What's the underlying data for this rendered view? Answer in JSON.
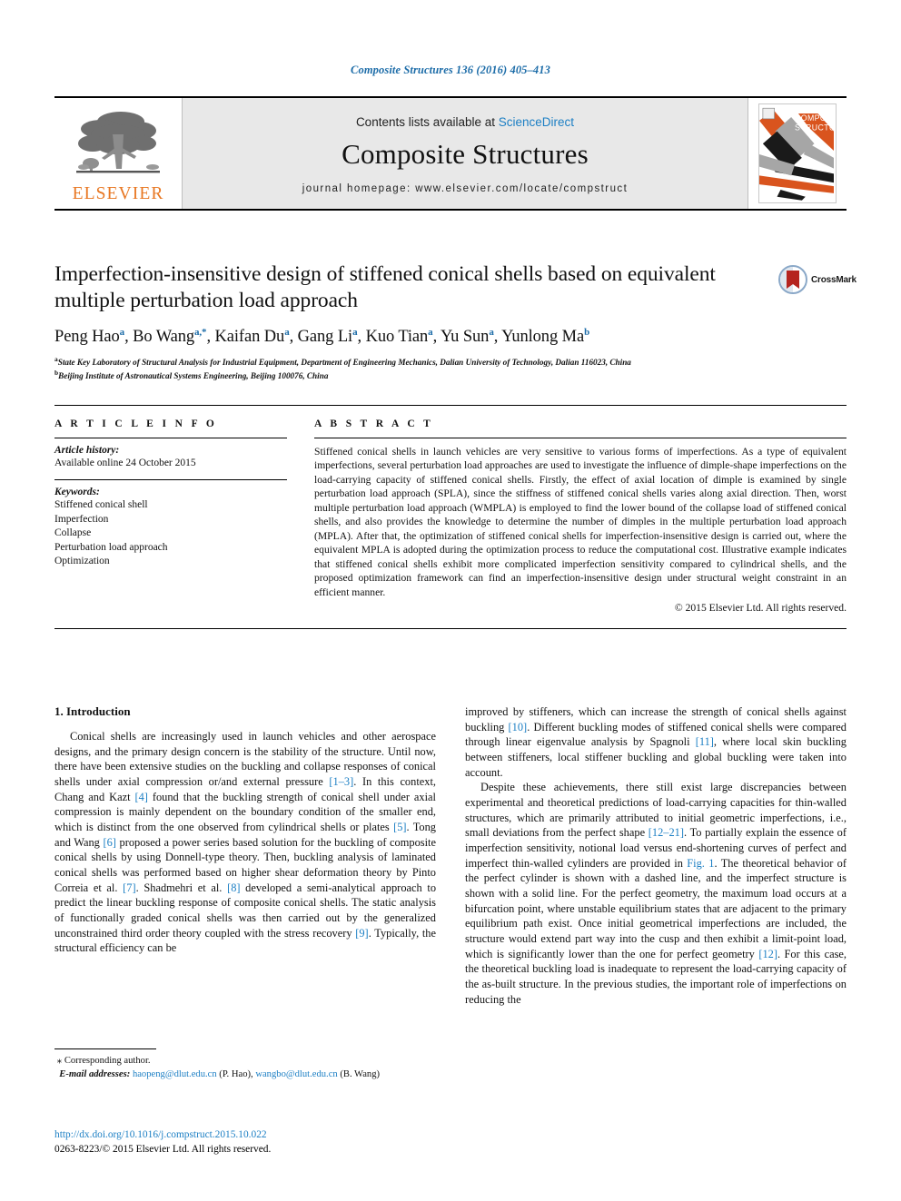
{
  "running_head": "Composite Structures 136 (2016) 405–413",
  "masthead": {
    "publisher_name": "ELSEVIER",
    "contents_prefix": "Contents lists available at ",
    "contents_link": "ScienceDirect",
    "journal_title": "Composite Structures",
    "homepage": "journal homepage: www.elsevier.com/locate/compstruct",
    "cover_line1": "COMPOSITE",
    "cover_line2": "STRUCTURES"
  },
  "article": {
    "title": "Imperfection-insensitive design of stiffened conical shells based on equivalent multiple perturbation load approach",
    "authors": [
      {
        "name": "Peng Hao",
        "sup": "a"
      },
      {
        "name": "Bo Wang",
        "sup": "a,*"
      },
      {
        "name": "Kaifan Du",
        "sup": "a"
      },
      {
        "name": "Gang Li",
        "sup": "a"
      },
      {
        "name": "Kuo Tian",
        "sup": "a"
      },
      {
        "name": "Yu Sun",
        "sup": "a"
      },
      {
        "name": "Yunlong Ma",
        "sup": "b"
      }
    ],
    "affiliations": [
      {
        "marker": "a",
        "text": "State Key Laboratory of Structural Analysis for Industrial Equipment, Department of Engineering Mechanics, Dalian University of Technology, Dalian 116023, China"
      },
      {
        "marker": "b",
        "text": "Beijing Institute of Astronautical Systems Engineering, Beijing 100076, China"
      }
    ],
    "crossmark_label": "CrossMark"
  },
  "article_info": {
    "heading": "A R T I C L E    I N F O",
    "history_label": "Article history:",
    "history_value": "Available online 24 October 2015",
    "keywords_label": "Keywords:",
    "keywords": [
      "Stiffened conical shell",
      "Imperfection",
      "Collapse",
      "Perturbation load approach",
      "Optimization"
    ]
  },
  "abstract": {
    "heading": "A B S T R A C T",
    "text": "Stiffened conical shells in launch vehicles are very sensitive to various forms of imperfections. As a type of equivalent imperfections, several perturbation load approaches are used to investigate the influence of dimple-shape imperfections on the load-carrying capacity of stiffened conical shells. Firstly, the effect of axial location of dimple is examined by single perturbation load approach (SPLA), since the stiffness of stiffened conical shells varies along axial direction. Then, worst multiple perturbation load approach (WMPLA) is employed to find the lower bound of the collapse load of stiffened conical shells, and also provides the knowledge to determine the number of dimples in the multiple perturbation load approach (MPLA). After that, the optimization of stiffened conical shells for imperfection-insensitive design is carried out, where the equivalent MPLA is adopted during the optimization process to reduce the computational cost. Illustrative example indicates that stiffened conical shells exhibit more complicated imperfection sensitivity compared to cylindrical shells, and the proposed optimization framework can find an imperfection-insensitive design under structural weight constraint in an efficient manner.",
    "copyright": "© 2015 Elsevier Ltd. All rights reserved."
  },
  "body": {
    "section_title": "1. Introduction",
    "left_paragraph_html": "Conical shells are increasingly used in launch vehicles and other aerospace designs, and the primary design concern is the stability of the structure. Until now, there have been extensive studies on the buckling and collapse responses of conical shells under axial compression or/and external pressure <span class=\"ref\">[1–3]</span>. In this context, Chang and Kazt <span class=\"ref\">[4]</span> found that the buckling strength of conical shell under axial compression is mainly dependent on the boundary condition of the smaller end, which is distinct from the one observed from cylindrical shells or plates <span class=\"ref\">[5]</span>. Tong and Wang <span class=\"ref\">[6]</span> proposed a power series based solution for the buckling of composite conical shells by using Donnell-type theory. Then, buckling analysis of laminated conical shells was performed based on higher shear deformation theory by Pinto Correia et al. <span class=\"ref\">[7]</span>. Shadmehri et al. <span class=\"ref\">[8]</span> developed a semi-analytical approach to predict the linear buckling response of composite conical shells. The static analysis of functionally graded conical shells was then carried out by the generalized unconstrained third order theory coupled with the stress recovery <span class=\"ref\">[9]</span>. Typically, the structural efficiency can be",
    "right_paragraph1_html": "improved by stiffeners, which can increase the strength of conical shells against buckling <span class=\"ref\">[10]</span>. Different buckling modes of stiffened conical shells were compared through linear eigenvalue analysis by Spagnoli <span class=\"ref\">[11]</span>, where local skin buckling between stiffeners, local stiffener buckling and global buckling were taken into account.",
    "right_paragraph2_html": "Despite these achievements, there still exist large discrepancies between experimental and theoretical predictions of load-carrying capacities for thin-walled structures, which are primarily attributed to initial geometric imperfections, i.e., small deviations from the perfect shape <span class=\"ref\">[12–21]</span>. To partially explain the essence of imperfection sensitivity, notional load versus end-shortening curves of perfect and imperfect thin-walled cylinders are provided in <span class=\"ref\">Fig. 1</span>. The theoretical behavior of the perfect cylinder is shown with a dashed line, and the imperfect structure is shown with a solid line. For the perfect geometry, the maximum load occurs at a bifurcation point, where unstable equilibrium states that are adjacent to the primary equilibrium path exist. Once initial geometrical imperfections are included, the structure would extend part way into the cusp and then exhibit a limit-point load, which is significantly lower than the one for perfect geometry <span class=\"ref\">[12]</span>. For this case, the theoretical buckling load is inadequate to represent the load-carrying capacity of the as-built structure. In the previous studies, the important role of imperfections on reducing the"
  },
  "footnote": {
    "corresponding_marker": "⁎",
    "corresponding_text": "Corresponding author.",
    "email_label": "E-mail addresses:",
    "emails": [
      {
        "address": "haopeng@dlut.edu.cn",
        "person": "(P. Hao)"
      },
      {
        "address": "wangbo@dlut.edu.cn",
        "person": "(B. Wang)"
      }
    ]
  },
  "doi_block": {
    "doi_url": "http://dx.doi.org/10.1016/j.compstruct.2015.10.022",
    "issn_line": "0263-8223/© 2015 Elsevier Ltd. All rights reserved."
  },
  "colors": {
    "link_blue": "#1c7fc4",
    "runhead_blue": "#1c6ca8",
    "elsevier_orange": "#e87722",
    "cover_orange": "#d9541e",
    "cover_gray": "#a6a6a6",
    "crossmark_red": "#b5241f"
  }
}
